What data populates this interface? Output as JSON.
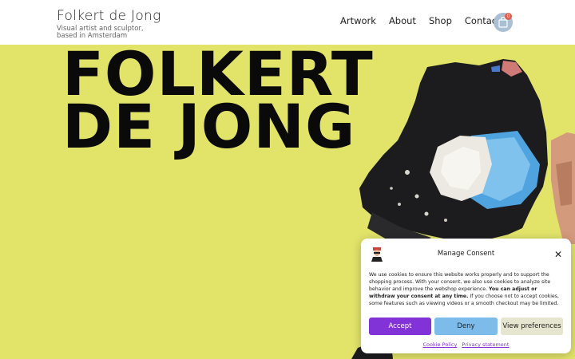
{
  "header": {
    "title": "Folkert de Jong",
    "tagline": "Visual artist and sculptor, based in Amsterdam"
  },
  "nav": {
    "items": [
      {
        "label": "Artwork"
      },
      {
        "label": "About"
      },
      {
        "label": "Shop"
      },
      {
        "label": "Contact"
      }
    ]
  },
  "cart": {
    "icon": "shopping-bag-icon",
    "count": "0"
  },
  "hero": {
    "title_line1": "FOLKERT",
    "title_line2": "DE JONG",
    "background_color": "#e2e46a"
  },
  "consent": {
    "title": "Manage Consent",
    "body_intro": "We use cookies to ensure this website works properly and to support the shopping process. With your consent, we also use cookies to analyze site behavior and improve the webshop experience. ",
    "body_bold": "You can adjust or withdraw your consent at any time.",
    "body_tail": " If you choose not to accept cookies, some features such as viewing videos or a smooth checkout may be limited.",
    "accept_label": "Accept",
    "deny_label": "Deny",
    "preferences_label": "View preferences",
    "cookie_policy_label": "Cookie Policy",
    "privacy_label": "Privacy statement",
    "accent_color": "#8133d8"
  }
}
